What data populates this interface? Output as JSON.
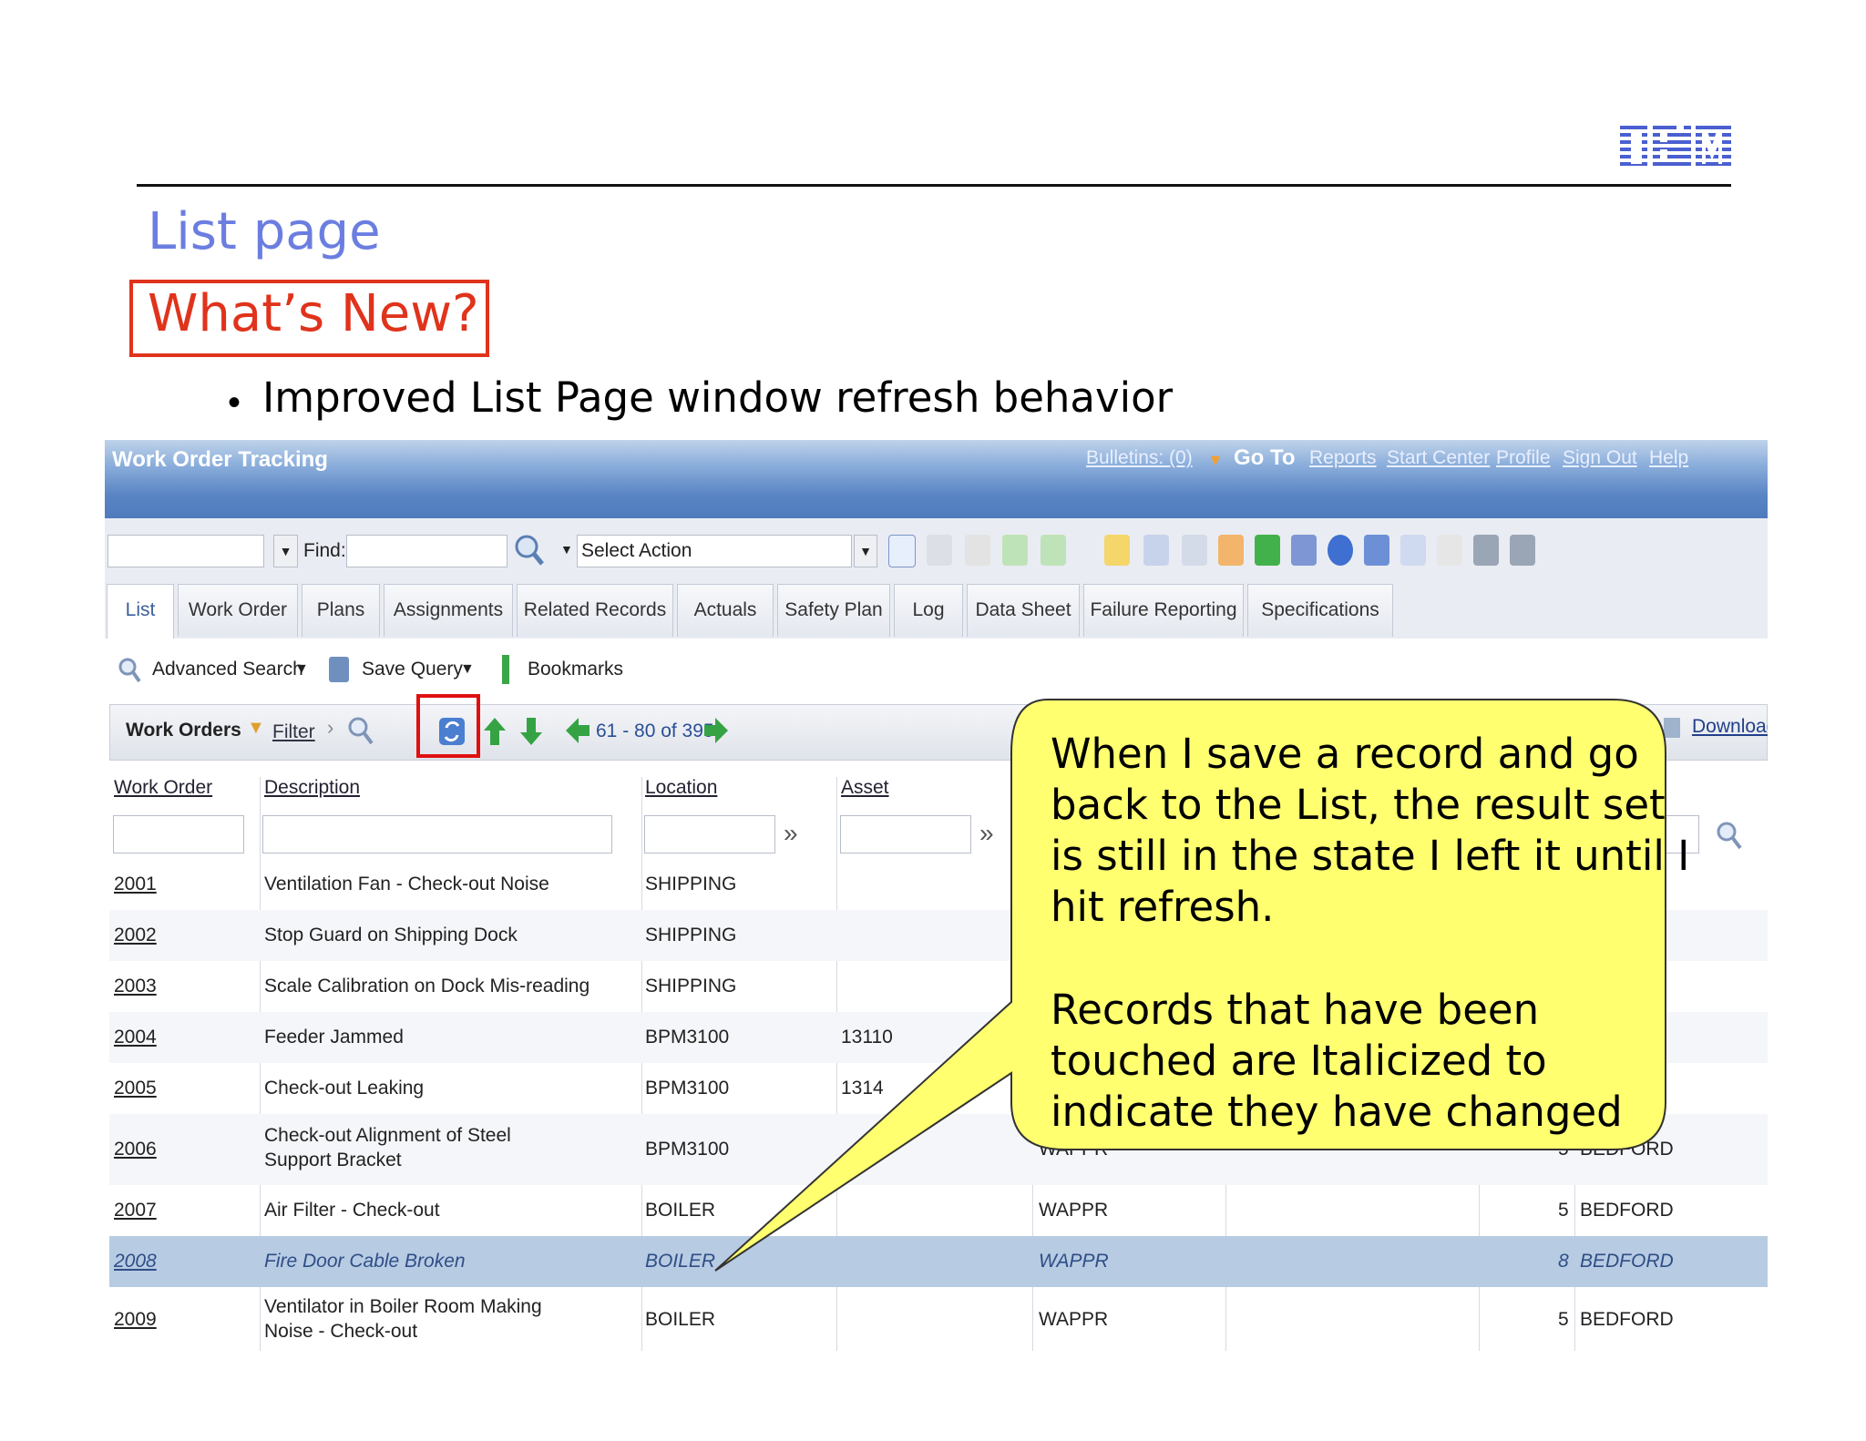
{
  "slide": {
    "logo_text": "IBM",
    "title": "List page",
    "whats_new": "What’s New?",
    "bullet": "Improved List Page window refresh behavior"
  },
  "app": {
    "title": "Work Order Tracking",
    "header_links": {
      "bulletins": "Bulletins: (0)",
      "goto": "Go To",
      "reports": "Reports",
      "start_center": "Start Center",
      "profile": "Profile",
      "sign_out": "Sign Out",
      "help": "Help"
    },
    "toolbar": {
      "find_label": "Find:",
      "select_action": "Select Action"
    },
    "tabs": [
      "List",
      "Work Order",
      "Plans",
      "Assignments",
      "Related Records",
      "Actuals",
      "Safety Plan",
      "Log",
      "Data Sheet",
      "Failure Reporting",
      "Specifications"
    ],
    "subbar": {
      "advanced_search": "Advanced Search",
      "save_query": "Save Query",
      "bookmarks": "Bookmarks"
    },
    "table": {
      "title": "Work Orders",
      "filter": "Filter",
      "paging": "61 - 80 of 395",
      "download": "Download",
      "columns": [
        "Work Order",
        "Description",
        "Location",
        "Asset"
      ],
      "rows": [
        {
          "wo": "2001",
          "desc": "Ventilation Fan - Check-out Noise",
          "loc": "SHIPPING",
          "asset": "",
          "status": "",
          "pri": "",
          "site": ""
        },
        {
          "wo": "2002",
          "desc": "Stop Guard on Shipping Dock",
          "loc": "SHIPPING",
          "asset": "",
          "status": "",
          "pri": "",
          "site": ""
        },
        {
          "wo": "2003",
          "desc": "Scale Calibration on Dock Mis-reading",
          "loc": "SHIPPING",
          "asset": "",
          "status": "",
          "pri": "",
          "site": ""
        },
        {
          "wo": "2004",
          "desc": "Feeder Jammed",
          "loc": "BPM3100",
          "asset": "13110",
          "status": "",
          "pri": "",
          "site": ""
        },
        {
          "wo": "2005",
          "desc": "Check-out Leaking",
          "loc": "BPM3100",
          "asset": "1314",
          "status": "",
          "pri": "",
          "site": ""
        },
        {
          "wo": "2006",
          "desc": "Check-out Alignment of Steel Support Bracket",
          "loc": "BPM3100",
          "asset": "",
          "status": "WAPPR",
          "pri": "5",
          "site": "BEDFORD"
        },
        {
          "wo": "2007",
          "desc": "Air Filter - Check-out",
          "loc": "BOILER",
          "asset": "",
          "status": "WAPPR",
          "pri": "5",
          "site": "BEDFORD"
        },
        {
          "wo": "2008",
          "desc": "Fire Door Cable Broken",
          "loc": "BOILER",
          "asset": "",
          "status": "WAPPR",
          "pri": "8",
          "site": "BEDFORD"
        },
        {
          "wo": "2009",
          "desc": "Ventilator in Boiler Room Making Noise - Check-out",
          "loc": "BOILER",
          "asset": "",
          "status": "WAPPR",
          "pri": "5",
          "site": "BEDFORD"
        }
      ]
    }
  },
  "callout": {
    "para1_lines": [
      "When I save a record and go",
      "back to the List, the result set",
      "is still in the state I left it until I",
      "hit refresh."
    ],
    "para2_lines": [
      "Records that have been",
      "touched are Italicized to",
      "indicate they have changed"
    ]
  },
  "colors": {
    "callout_fill": "#ffff70",
    "highlight_row": "#b7cbe3",
    "red": "#e0331c",
    "title_blue": "#6b7ee0"
  }
}
